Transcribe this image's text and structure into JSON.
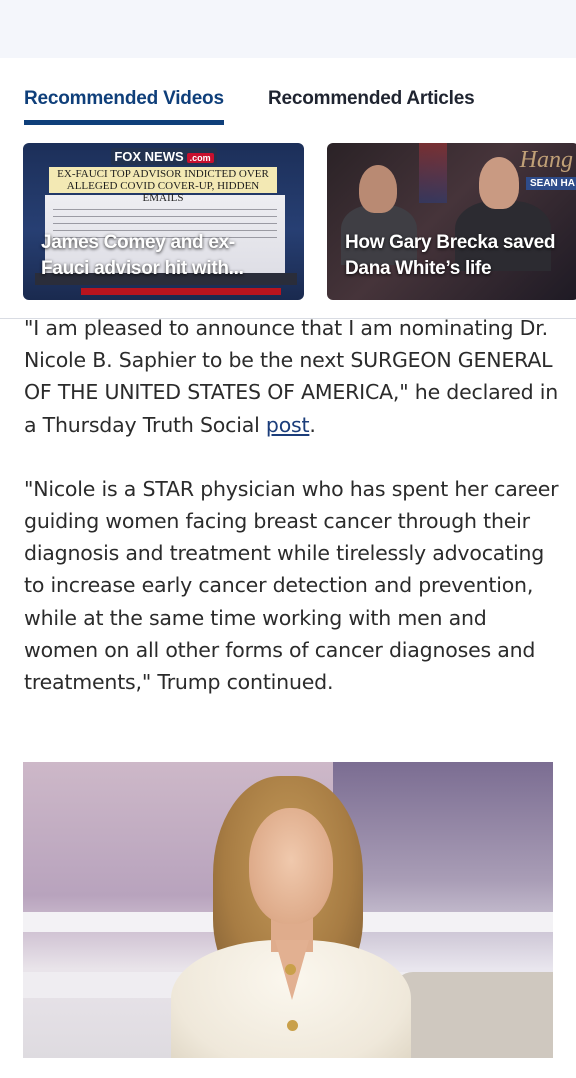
{
  "tabs": {
    "videos_label": "Recommended Videos",
    "articles_label": "Recommended Articles",
    "active": "videos"
  },
  "videos": [
    {
      "title": "James Comey and ex-Fauci advisor hit with...",
      "title_line1": "James Comey and ex-",
      "title_line2": "Fauci advisor hit with...",
      "thumb_logo": "FOX NEWS",
      "thumb_logo_suffix": ".com",
      "thumb_headline_1": "EX-FAUCI TOP ADVISOR INDICTED OVER",
      "thumb_headline_2": "ALLEGED COVID COVER-UP, HIDDEN EMAILS"
    },
    {
      "title": "How Gary Brecka saved Dana White's life",
      "title_line1": "How Gary Brecka saved",
      "title_line2": "Dana White’s life",
      "thumb_logo": "Hang",
      "thumb_logo_sub": "SEAN HA"
    }
  ],
  "article": {
    "paragraph1_text": "\"I am pleased to announce that I am nominating Dr. Nicole B. Saphier to be the next SURGEON GENERAL OF THE UNITED STATES OF AMERICA,\" he declared in a Thursday Truth Social ",
    "paragraph1_link": "post",
    "paragraph1_end": ".",
    "paragraph2": "\"Nicole is a STAR physician who has spent her career guiding women facing breast cancer through their diagnosis and treatment while tirelessly advocating to increase early cancer detection and prevention, while at the same time working with men and women on all other forms of cancer diagnoses and treatments,\" Trump continued."
  },
  "colors": {
    "brand_navy": "#0f3f7a",
    "link": "#1b3d7a",
    "top_band": "#f4f6fb"
  }
}
